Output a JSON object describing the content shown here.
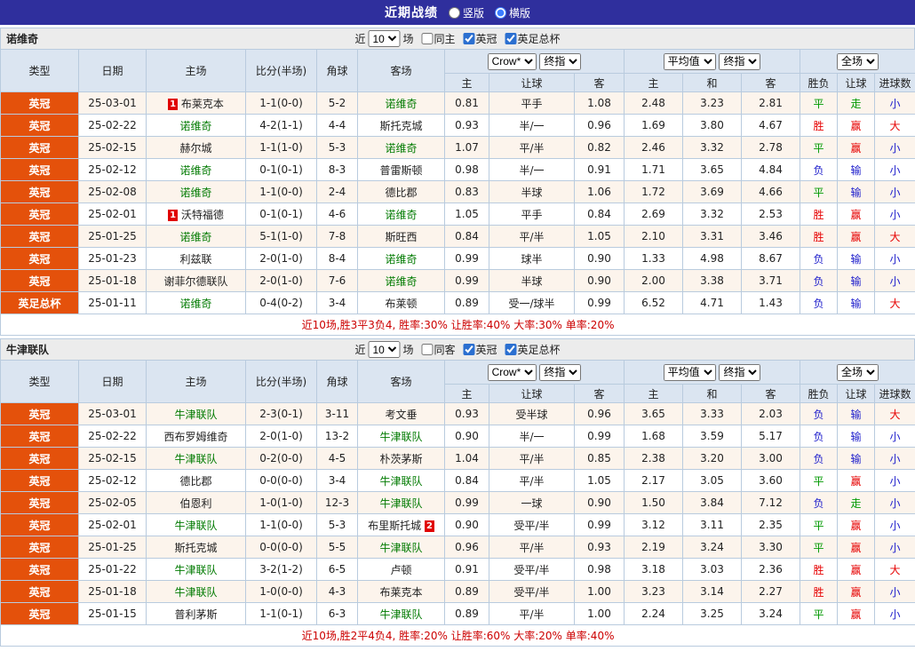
{
  "top_bar": {
    "title": "近期战绩",
    "vertical_label": "竖版",
    "horizontal_label": "横版",
    "vertical_selected": false,
    "horizontal_selected": true
  },
  "filters_labels": {
    "near": "近",
    "games": "场"
  },
  "table_header": {
    "type": "类型",
    "date": "日期",
    "home": "主场",
    "score": "比分(半场)",
    "corner": "角球",
    "away": "客场",
    "odds_source": "Crow*",
    "odds_time": "终指",
    "avg_source": "平均值",
    "avg_time": "终指",
    "scope": "全场",
    "sub_home": "主",
    "sub_handicap": "让球",
    "sub_away": "客",
    "sub_avg_home": "主",
    "sub_draw": "和",
    "sub_avg_away": "客",
    "sub_result": "胜负",
    "sub_cover": "让球",
    "sub_goals": "进球数"
  },
  "colors": {
    "topbar_bg": "#2f2f9d",
    "header_bg": "#dbe5f1",
    "grid_border": "#b9cbde",
    "type_bg": "#e4510b",
    "team_link": "#007a00",
    "win": "#e60000",
    "draw": "#009900",
    "lose": "#2020cc",
    "summary": "#cc0000",
    "alt_row": "#fcf4ec",
    "filter_bg": "#ececec"
  },
  "sections": [
    {
      "team": "诺维奇",
      "filters": {
        "games_value": "10",
        "same_label": "同主",
        "same_checked": false,
        "league1": "英冠",
        "league1_checked": true,
        "league2": "英足总杯",
        "league2_checked": true
      },
      "rows": [
        {
          "type": "英冠",
          "date": "25-03-01",
          "home": "布莱克本",
          "home_badge": "1",
          "score": "1-1(0-0)",
          "corners": "5-2",
          "away": "诺维奇",
          "away_green": true,
          "odds": [
            "0.81",
            "平手",
            "1.08"
          ],
          "avg": [
            "2.48",
            "3.23",
            "2.81"
          ],
          "outcome": [
            "平",
            "走",
            "小"
          ],
          "outcome_colors": [
            "g",
            "g",
            "b"
          ]
        },
        {
          "type": "英冠",
          "date": "25-02-22",
          "home": "诺维奇",
          "home_green": true,
          "score": "4-2(1-1)",
          "corners": "4-4",
          "away": "斯托克城",
          "odds": [
            "0.93",
            "半/一",
            "0.96"
          ],
          "avg": [
            "1.69",
            "3.80",
            "4.67"
          ],
          "outcome": [
            "胜",
            "赢",
            "大"
          ],
          "outcome_colors": [
            "r",
            "r",
            "r"
          ]
        },
        {
          "type": "英冠",
          "date": "25-02-15",
          "home": "赫尔城",
          "score": "1-1(1-0)",
          "corners": "5-3",
          "away": "诺维奇",
          "away_green": true,
          "odds": [
            "1.07",
            "平/半",
            "0.82"
          ],
          "avg": [
            "2.46",
            "3.32",
            "2.78"
          ],
          "outcome": [
            "平",
            "赢",
            "小"
          ],
          "outcome_colors": [
            "g",
            "r",
            "b"
          ]
        },
        {
          "type": "英冠",
          "date": "25-02-12",
          "home": "诺维奇",
          "home_green": true,
          "score": "0-1(0-1)",
          "corners": "8-3",
          "away": "普雷斯顿",
          "odds": [
            "0.98",
            "半/一",
            "0.91"
          ],
          "avg": [
            "1.71",
            "3.65",
            "4.84"
          ],
          "outcome": [
            "负",
            "输",
            "小"
          ],
          "outcome_colors": [
            "b",
            "b",
            "b"
          ]
        },
        {
          "type": "英冠",
          "date": "25-02-08",
          "home": "诺维奇",
          "home_green": true,
          "score": "1-1(0-0)",
          "corners": "2-4",
          "away": "德比郡",
          "odds": [
            "0.83",
            "半球",
            "1.06"
          ],
          "avg": [
            "1.72",
            "3.69",
            "4.66"
          ],
          "outcome": [
            "平",
            "输",
            "小"
          ],
          "outcome_colors": [
            "g",
            "b",
            "b"
          ]
        },
        {
          "type": "英冠",
          "date": "25-02-01",
          "home": "沃特福德",
          "home_badge": "1",
          "score": "0-1(0-1)",
          "corners": "4-6",
          "away": "诺维奇",
          "away_green": true,
          "odds": [
            "1.05",
            "平手",
            "0.84"
          ],
          "avg": [
            "2.69",
            "3.32",
            "2.53"
          ],
          "outcome": [
            "胜",
            "赢",
            "小"
          ],
          "outcome_colors": [
            "r",
            "r",
            "b"
          ]
        },
        {
          "type": "英冠",
          "date": "25-01-25",
          "home": "诺维奇",
          "home_green": true,
          "score": "5-1(1-0)",
          "corners": "7-8",
          "away": "斯旺西",
          "odds": [
            "0.84",
            "平/半",
            "1.05"
          ],
          "avg": [
            "2.10",
            "3.31",
            "3.46"
          ],
          "outcome": [
            "胜",
            "赢",
            "大"
          ],
          "outcome_colors": [
            "r",
            "r",
            "r"
          ]
        },
        {
          "type": "英冠",
          "date": "25-01-23",
          "home": "利兹联",
          "score": "2-0(1-0)",
          "corners": "8-4",
          "away": "诺维奇",
          "away_green": true,
          "odds": [
            "0.99",
            "球半",
            "0.90"
          ],
          "avg": [
            "1.33",
            "4.98",
            "8.67"
          ],
          "outcome": [
            "负",
            "输",
            "小"
          ],
          "outcome_colors": [
            "b",
            "b",
            "b"
          ]
        },
        {
          "type": "英冠",
          "date": "25-01-18",
          "home": "谢菲尔德联队",
          "score": "2-0(1-0)",
          "corners": "7-6",
          "away": "诺维奇",
          "away_green": true,
          "odds": [
            "0.99",
            "半球",
            "0.90"
          ],
          "avg": [
            "2.00",
            "3.38",
            "3.71"
          ],
          "outcome": [
            "负",
            "输",
            "小"
          ],
          "outcome_colors": [
            "b",
            "b",
            "b"
          ]
        },
        {
          "type": "英足总杯",
          "date": "25-01-11",
          "home": "诺维奇",
          "home_green": true,
          "score": "0-4(0-2)",
          "corners": "3-4",
          "away": "布莱顿",
          "odds": [
            "0.89",
            "受一/球半",
            "0.99"
          ],
          "avg": [
            "6.52",
            "4.71",
            "1.43"
          ],
          "outcome": [
            "负",
            "输",
            "大"
          ],
          "outcome_colors": [
            "b",
            "b",
            "r"
          ]
        }
      ],
      "summary": "近10场,胜3平3负4, 胜率:30% 让胜率:40% 大率:30% 单率:20%"
    },
    {
      "team": "牛津联队",
      "filters": {
        "games_value": "10",
        "same_label": "同客",
        "same_checked": false,
        "league1": "英冠",
        "league1_checked": true,
        "league2": "英足总杯",
        "league2_checked": true
      },
      "rows": [
        {
          "type": "英冠",
          "date": "25-03-01",
          "home": "牛津联队",
          "home_green": true,
          "score": "2-3(0-1)",
          "corners": "3-11",
          "away": "考文垂",
          "odds": [
            "0.93",
            "受半球",
            "0.96"
          ],
          "avg": [
            "3.65",
            "3.33",
            "2.03"
          ],
          "outcome": [
            "负",
            "输",
            "大"
          ],
          "outcome_colors": [
            "b",
            "b",
            "r"
          ]
        },
        {
          "type": "英冠",
          "date": "25-02-22",
          "home": "西布罗姆维奇",
          "score": "2-0(1-0)",
          "corners": "13-2",
          "away": "牛津联队",
          "away_green": true,
          "odds": [
            "0.90",
            "半/一",
            "0.99"
          ],
          "avg": [
            "1.68",
            "3.59",
            "5.17"
          ],
          "outcome": [
            "负",
            "输",
            "小"
          ],
          "outcome_colors": [
            "b",
            "b",
            "b"
          ]
        },
        {
          "type": "英冠",
          "date": "25-02-15",
          "home": "牛津联队",
          "home_green": true,
          "score": "0-2(0-0)",
          "corners": "4-5",
          "away": "朴茨茅斯",
          "odds": [
            "1.04",
            "平/半",
            "0.85"
          ],
          "avg": [
            "2.38",
            "3.20",
            "3.00"
          ],
          "outcome": [
            "负",
            "输",
            "小"
          ],
          "outcome_colors": [
            "b",
            "b",
            "b"
          ]
        },
        {
          "type": "英冠",
          "date": "25-02-12",
          "home": "德比郡",
          "score": "0-0(0-0)",
          "corners": "3-4",
          "away": "牛津联队",
          "away_green": true,
          "odds": [
            "0.84",
            "平/半",
            "1.05"
          ],
          "avg": [
            "2.17",
            "3.05",
            "3.60"
          ],
          "outcome": [
            "平",
            "赢",
            "小"
          ],
          "outcome_colors": [
            "g",
            "r",
            "b"
          ]
        },
        {
          "type": "英冠",
          "date": "25-02-05",
          "home": "伯恩利",
          "score": "1-0(1-0)",
          "corners": "12-3",
          "away": "牛津联队",
          "away_green": true,
          "odds": [
            "0.99",
            "一球",
            "0.90"
          ],
          "avg": [
            "1.50",
            "3.84",
            "7.12"
          ],
          "outcome": [
            "负",
            "走",
            "小"
          ],
          "outcome_colors": [
            "b",
            "g",
            "b"
          ]
        },
        {
          "type": "英冠",
          "date": "25-02-01",
          "home": "牛津联队",
          "home_green": true,
          "score": "1-1(0-0)",
          "corners": "5-3",
          "away": "布里斯托城",
          "away_badge": "2",
          "odds": [
            "0.90",
            "受平/半",
            "0.99"
          ],
          "avg": [
            "3.12",
            "3.11",
            "2.35"
          ],
          "outcome": [
            "平",
            "赢",
            "小"
          ],
          "outcome_colors": [
            "g",
            "r",
            "b"
          ]
        },
        {
          "type": "英冠",
          "date": "25-01-25",
          "home": "斯托克城",
          "score": "0-0(0-0)",
          "corners": "5-5",
          "away": "牛津联队",
          "away_green": true,
          "odds": [
            "0.96",
            "平/半",
            "0.93"
          ],
          "avg": [
            "2.19",
            "3.24",
            "3.30"
          ],
          "outcome": [
            "平",
            "赢",
            "小"
          ],
          "outcome_colors": [
            "g",
            "r",
            "b"
          ]
        },
        {
          "type": "英冠",
          "date": "25-01-22",
          "home": "牛津联队",
          "home_green": true,
          "score": "3-2(1-2)",
          "corners": "6-5",
          "away": "卢顿",
          "odds": [
            "0.91",
            "受平/半",
            "0.98"
          ],
          "avg": [
            "3.18",
            "3.03",
            "2.36"
          ],
          "outcome": [
            "胜",
            "赢",
            "大"
          ],
          "outcome_colors": [
            "r",
            "r",
            "r"
          ]
        },
        {
          "type": "英冠",
          "date": "25-01-18",
          "home": "牛津联队",
          "home_green": true,
          "score": "1-0(0-0)",
          "corners": "4-3",
          "away": "布莱克本",
          "odds": [
            "0.89",
            "受平/半",
            "1.00"
          ],
          "avg": [
            "3.23",
            "3.14",
            "2.27"
          ],
          "outcome": [
            "胜",
            "赢",
            "小"
          ],
          "outcome_colors": [
            "r",
            "r",
            "b"
          ]
        },
        {
          "type": "英冠",
          "date": "25-01-15",
          "home": "普利茅斯",
          "score": "1-1(0-1)",
          "corners": "6-3",
          "away": "牛津联队",
          "away_green": true,
          "odds": [
            "0.89",
            "平/半",
            "1.00"
          ],
          "avg": [
            "2.24",
            "3.25",
            "3.24"
          ],
          "outcome": [
            "平",
            "赢",
            "小"
          ],
          "outcome_colors": [
            "g",
            "r",
            "b"
          ]
        }
      ],
      "summary": "近10场,胜2平4负4, 胜率:20% 让胜率:60% 大率:20% 单率:40%"
    }
  ]
}
